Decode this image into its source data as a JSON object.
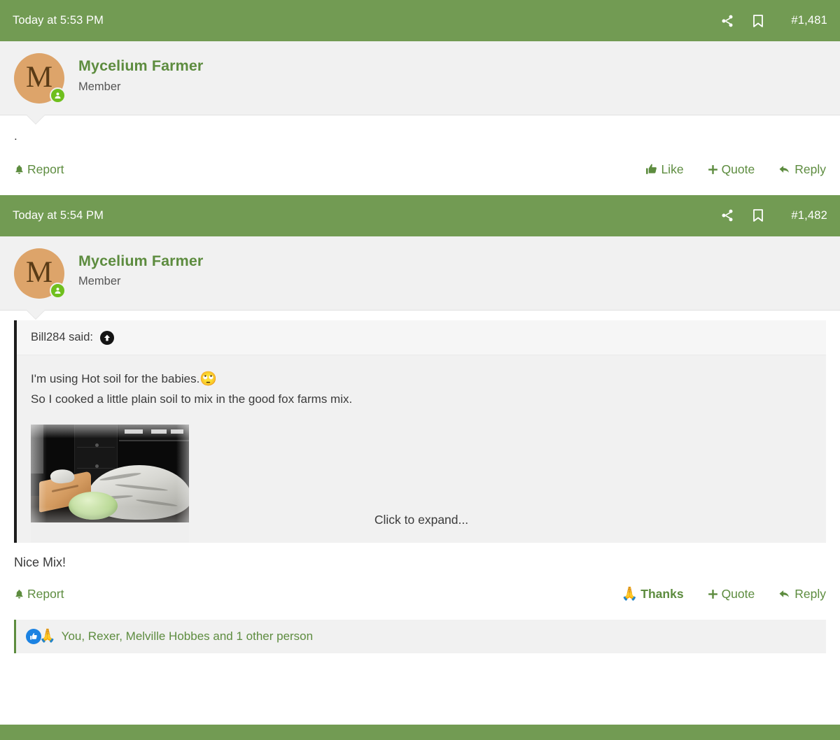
{
  "posts": [
    {
      "date": "Today at 5:53 PM",
      "post_number": "#1,481",
      "author": "Mycelium Farmer",
      "author_title": "Member",
      "avatar_letter": "M",
      "body_text": ".",
      "report_label": "Report",
      "like_label": "Like",
      "quote_label": "Quote",
      "reply_label": "Reply"
    },
    {
      "date": "Today at 5:54 PM",
      "post_number": "#1,482",
      "author": "Mycelium Farmer",
      "author_title": "Member",
      "avatar_letter": "M",
      "quote": {
        "attribution": "Bill284 said:",
        "jump_icon": "arrow-up-circle-icon",
        "lines": [
          "I'm using Hot soil for the babies.",
          "So I cooked a little plain soil to mix in the good fox farms mix."
        ],
        "line_emoji": "🙄",
        "attachment_alt": "photo of foil-covered tray, paper bag and green bowl on a kitchen counter",
        "expand_label": "Click to expand..."
      },
      "body_text": "Nice Mix!",
      "report_label": "Report",
      "thanks_label": "Thanks",
      "thanks_emoji": "🙏",
      "quote_label": "Quote",
      "reply_label": "Reply",
      "reactions": {
        "emoji": "🙏",
        "text": "You, Rexer, Melville Hobbes and 1 other person"
      }
    }
  ],
  "colors": {
    "header_green": "#729b53",
    "link_green": "#5d8c3f",
    "avatar_bg": "#dda46a",
    "online_green": "#6fbf1e",
    "reaction_blue": "#1b82e2",
    "quote_border": "#1d1d1d",
    "userbar_bg": "#f1f1f1"
  }
}
